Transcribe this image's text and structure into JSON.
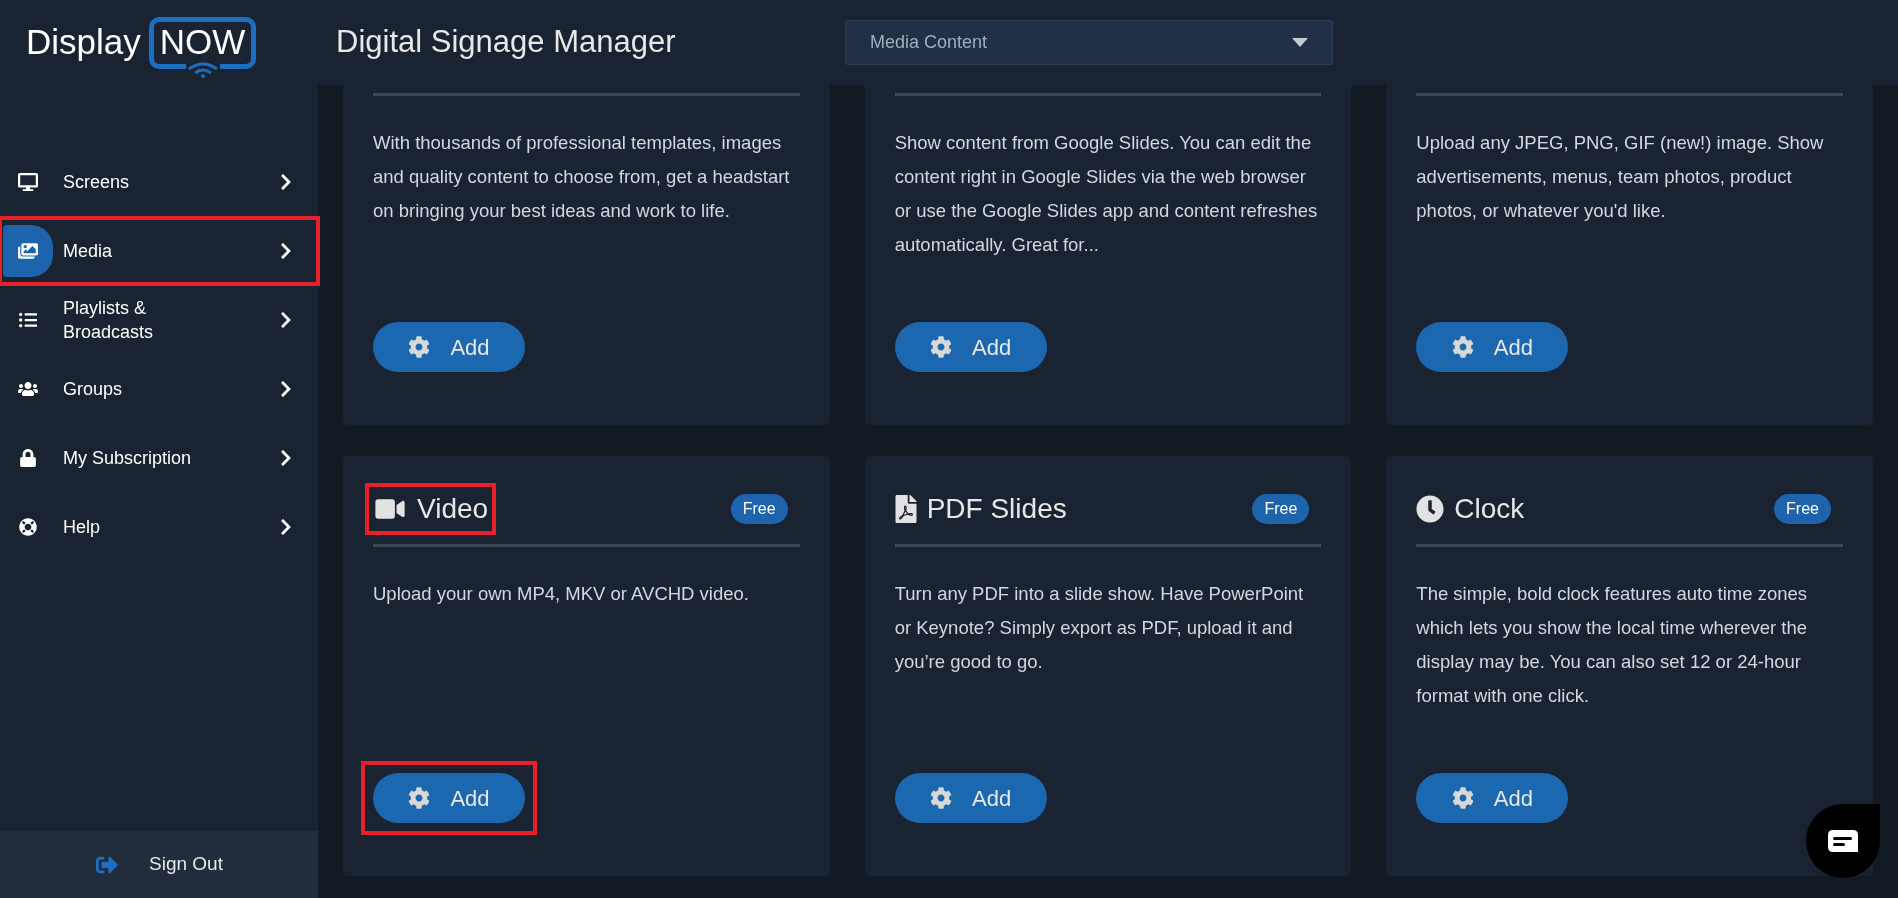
{
  "logo": {
    "word": "Display",
    "badge": "NOW"
  },
  "header": {
    "title": "Digital Signage Manager",
    "dropdown": {
      "value": "Media Content"
    }
  },
  "sidebar": {
    "items": [
      {
        "label": "Screens",
        "selected": false,
        "highlighted": false
      },
      {
        "label": "Media",
        "selected": true,
        "highlighted": true
      },
      {
        "label": "Playlists & Broadcasts",
        "selected": false,
        "highlighted": false
      },
      {
        "label": "Groups",
        "selected": false,
        "highlighted": false
      },
      {
        "label": "My Subscription",
        "selected": false,
        "highlighted": false
      },
      {
        "label": "Help",
        "selected": false,
        "highlighted": false
      }
    ],
    "sign_out": "Sign Out"
  },
  "cards": [
    {
      "description": "With thousands of professional templates, images and quality content to choose from, get a headstart on bringing your best ideas and work to life.",
      "button": "Add",
      "button_highlighted": false
    },
    {
      "description": "Show content from Google Slides. You can edit the content right in Google Slides via the web browser or use the Google Slides app and content refreshes automatically. Great for...",
      "button": "Add",
      "button_highlighted": false
    },
    {
      "description": "Upload any JPEG, PNG, GIF (new!) image. Show advertisements, menus, team photos, product photos, or whatever you'd like.",
      "button": "Add",
      "button_highlighted": false
    },
    {
      "kind": "video",
      "title": "Video",
      "badge": "Free",
      "description": "Upload your own MP4, MKV or AVCHD video.",
      "button": "Add",
      "title_highlighted": true,
      "button_highlighted": true
    },
    {
      "kind": "pdf",
      "title": "PDF Slides",
      "badge": "Free",
      "description": "Turn any PDF into a slide show. Have PowerPoint or Keynote? Simply export as PDF, upload it and you’re good to go.",
      "button": "Add",
      "title_highlighted": false,
      "button_highlighted": false
    },
    {
      "kind": "clock",
      "title": "Clock",
      "badge": "Free",
      "description": "The simple, bold clock features auto time zones which lets you show the local time wherever the display may be. You can also set 12 or 24-hour format with one click.",
      "button": "Add",
      "title_highlighted": false,
      "button_highlighted": false
    }
  ]
}
